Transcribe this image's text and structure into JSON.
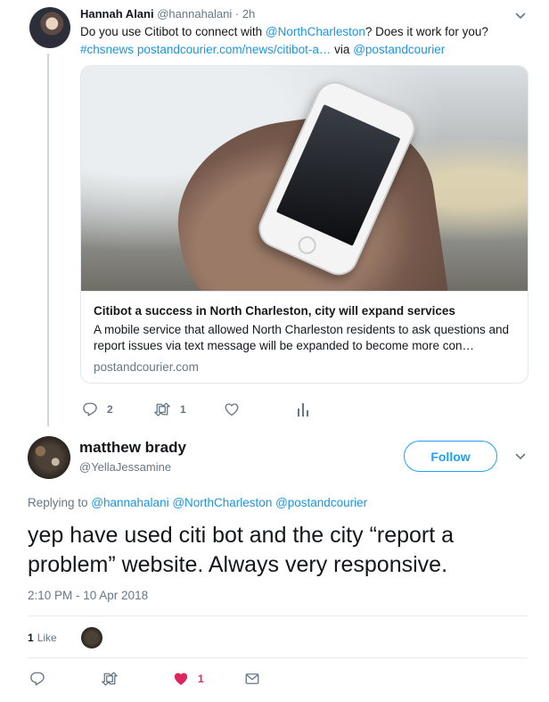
{
  "parent_tweet": {
    "name": "Hannah Alani",
    "handle": "@hannahalani",
    "time": "· 2h",
    "text_plain_1": "Do you use Citibot to connect with ",
    "text_mention_1": "@NorthCharleston",
    "text_plain_2": "? Does it work for you?",
    "text_hashtag": "#chsnews",
    "text_url": "postandcourier.com/news/citibot-a…",
    "text_via": " via ",
    "text_mention_2": "@postandcourier",
    "card": {
      "title": "Citibot a success in North Charleston, city will expand services",
      "description": "A mobile service that allowed North Charleston residents to ask questions and report issues via text message will be expanded to become more con…",
      "domain": "postandcourier.com"
    },
    "actions": {
      "reply_count": "2",
      "retweet_count": "1",
      "like_count": "",
      "analytics_icon": "bar-chart-icon"
    }
  },
  "main_tweet": {
    "name": "matthew brady",
    "handle": "@YellaJessamine",
    "follow_label": "Follow",
    "replying_prefix": "Replying to ",
    "replying_mentions": "@hannahalani @NorthCharleston @postandcourier",
    "text": "yep have used citi bot and the city “report a problem” website. Always very responsive.",
    "timestamp": "2:10 PM - 10 Apr 2018",
    "likes_count": "1",
    "likes_label": "Like",
    "actions": {
      "reply_count": "",
      "retweet_count": "",
      "like_count": "1",
      "like_color": "#e0245e"
    }
  },
  "colors": {
    "link": "#1b95e0",
    "follow": "#1da1f2",
    "muted": "#657786",
    "text": "#14171a"
  }
}
